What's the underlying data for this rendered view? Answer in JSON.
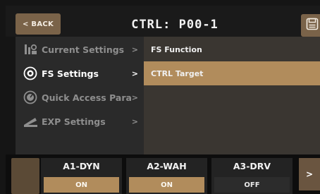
{
  "header": {
    "back_label": "< BACK",
    "title": "CTRL: P00-1",
    "save_icon": "save-icon"
  },
  "menu": {
    "items": [
      {
        "label": "Current Settings",
        "arrow": ">",
        "icon": "settings-icon",
        "active": false
      },
      {
        "label": "FS Settings",
        "arrow": ">",
        "icon": "footswitch-icon",
        "active": true
      },
      {
        "label": "Quick Access Para",
        "arrow": ">",
        "icon": "knob-icon",
        "active": false
      },
      {
        "label": "EXP Settings",
        "arrow": ">",
        "icon": "expression-pedal-icon",
        "active": false
      }
    ]
  },
  "submenu": {
    "items": [
      {
        "label": "FS Function",
        "selected": false
      },
      {
        "label": "CTRL Target",
        "selected": true
      }
    ]
  },
  "footer": {
    "slots": [
      {
        "name": "A1-DYN",
        "state": "ON"
      },
      {
        "name": "A2-WAH",
        "state": "ON"
      },
      {
        "name": "A3-DRV",
        "state": "OFF"
      }
    ],
    "next_label": ">"
  },
  "colors": {
    "accent": "#b18c5c",
    "button": "#7a6349",
    "menu_bg": "#2a2a2a",
    "submenu_bg": "#3a3631"
  }
}
